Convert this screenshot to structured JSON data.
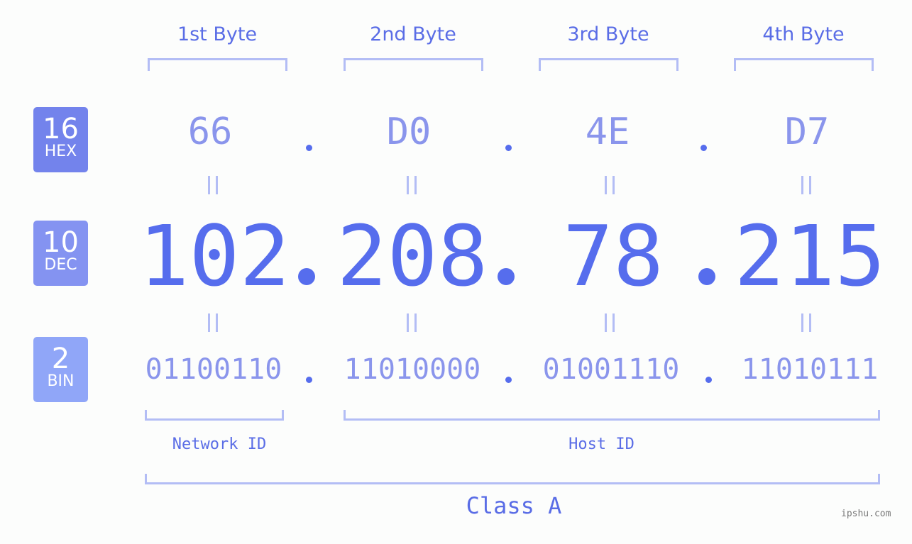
{
  "byte_headers": [
    "1st Byte",
    "2nd Byte",
    "3rd Byte",
    "4th Byte"
  ],
  "badges": {
    "hex": {
      "base": "16",
      "label": "HEX",
      "color": "#7383ec"
    },
    "dec": {
      "base": "10",
      "label": "DEC",
      "color": "#8493f1"
    },
    "bin": {
      "base": "2",
      "label": "BIN",
      "color": "#90a6f8"
    }
  },
  "hex_octets": [
    "66",
    "D0",
    "4E",
    "D7"
  ],
  "dec_octets": [
    "102",
    "208",
    "78",
    "215"
  ],
  "bin_octets": [
    "01100110",
    "11010000",
    "01001110",
    "11010111"
  ],
  "ip_address": "102.208.78.215",
  "network_label": "Network ID",
  "host_label": "Host ID",
  "class_label": "Class A",
  "watermark": "ipshu.com",
  "colors": {
    "primary": "#566ded",
    "light": "#8a95ec",
    "bracket": "#b3bdf5",
    "background": "#fcfdfc"
  }
}
